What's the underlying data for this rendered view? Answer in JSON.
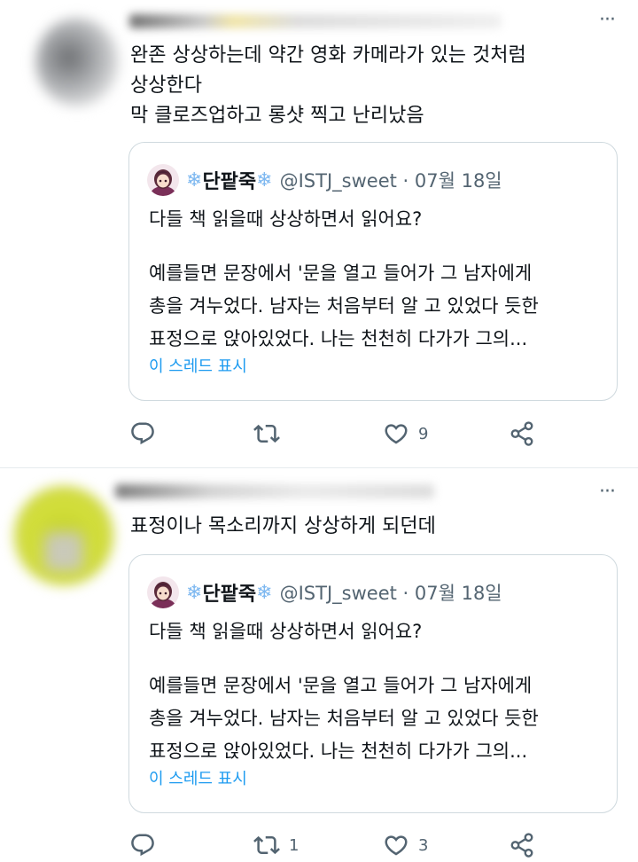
{
  "tweets": [
    {
      "text_lines": [
        "완존 상상하는데 약간 영화 카메라가 있는 것처럼",
        "상상한다",
        "막 클로즈업하고 롱샷 찍고 난리났음"
      ],
      "quote": {
        "name": "단팥죽",
        "handle_date": "@ISTJ_sweet · 07월 18일",
        "line1": "다들 책 읽을때 상상하면서 읽어요?",
        "line2": "예를들면 문장에서 '문을 열고 들어가 그 남자에게",
        "line3": "총을 겨누었다. 남자는 처음부터 알 고 있었다 듯한",
        "line4": "표정으로 앉아있었다. 나는 천천히 다가가 그의...",
        "show_thread": "이 스레드 표시"
      },
      "actions": {
        "reply": "",
        "retweet": "",
        "like": "9"
      }
    },
    {
      "text_lines": [
        "표정이나 목소리까지 상상하게 되던데"
      ],
      "quote": {
        "name": "단팥죽",
        "handle_date": "@ISTJ_sweet · 07월 18일",
        "line1": "다들 책 읽을때 상상하면서 읽어요?",
        "line2": "예를들면 문장에서 '문을 열고 들어가 그 남자에게",
        "line3": "총을 겨누었다. 남자는 처음부터 알 고 있었다 듯한",
        "line4": "표정으로 앉아있었다. 나는 천천히 다가가 그의...",
        "show_thread": "이 스레드 표시"
      },
      "actions": {
        "reply": "",
        "retweet": "1",
        "like": "3"
      }
    }
  ],
  "symbols": {
    "snowflake": "❄",
    "more": "···"
  },
  "icons": [
    "reply-icon",
    "retweet-icon",
    "like-icon",
    "share-icon",
    "more-icon"
  ],
  "colors": {
    "text": "#0f1419",
    "secondary": "#536471",
    "link": "#1d9bf0",
    "border": "#cfd9de",
    "snowflake": "#7cb7f0"
  }
}
